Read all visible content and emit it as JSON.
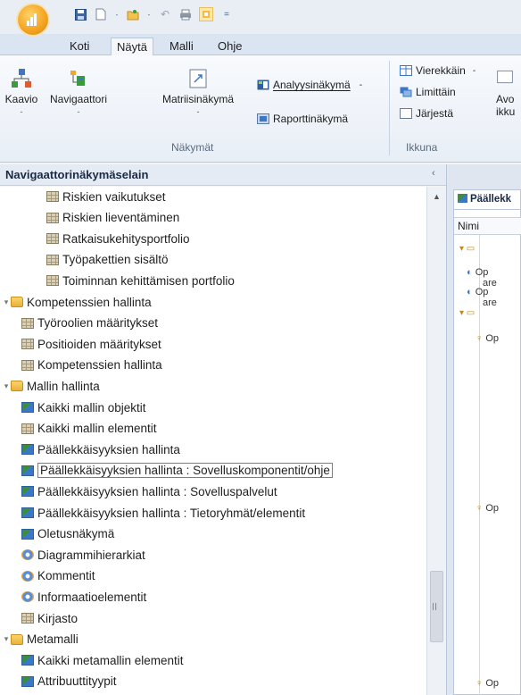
{
  "tabs": [
    "Koti",
    "Näytä",
    "Malli",
    "Ohje"
  ],
  "active_tab": "Näytä",
  "ribbon": {
    "large_buttons": [
      {
        "label": "Kaavio",
        "dropdown": "-"
      },
      {
        "label": "Navigaattori",
        "dropdown": "-"
      },
      {
        "label": "Matriisinäkymä",
        "dropdown": "-"
      }
    ],
    "view_buttons": [
      {
        "label": "Analyysinäkymä",
        "dropdown": "-"
      },
      {
        "label": "Raporttinäkymä"
      }
    ],
    "group_nakymat": "Näkymät",
    "window_buttons": [
      {
        "label": "Vierekkäin",
        "dropdown": "-"
      },
      {
        "label": "Limittäin"
      },
      {
        "label": "Järjestä"
      }
    ],
    "window_partial": {
      "line1": "Avo",
      "line2": "ikku"
    },
    "group_ikkuna": "Ikkuna"
  },
  "navigator": {
    "title": "Navigaattorinäkymäselain",
    "collapse_glyph": "‹",
    "items": [
      {
        "label": "Riskien vaikutukset",
        "level": 2,
        "icon": "grid"
      },
      {
        "label": "Riskien lieventäminen",
        "level": 2,
        "icon": "grid"
      },
      {
        "label": "Ratkaisukehitysportfolio",
        "level": 2,
        "icon": "grid"
      },
      {
        "label": "Työpakettien sisältö",
        "level": 2,
        "icon": "grid"
      },
      {
        "label": "Toiminnan kehittämisen portfolio",
        "level": 2,
        "icon": "grid"
      },
      {
        "label": "Kompetenssien hallinta",
        "level": 0,
        "icon": "folder"
      },
      {
        "label": "Työroolien määritykset",
        "level": 1,
        "icon": "grid"
      },
      {
        "label": "Positioiden määritykset",
        "level": 1,
        "icon": "grid"
      },
      {
        "label": "Kompetenssien hallinta",
        "level": 1,
        "icon": "grid"
      },
      {
        "label": "Mallin hallinta",
        "level": 0,
        "icon": "folder"
      },
      {
        "label": "Kaikki mallin objektit",
        "level": 1,
        "icon": "view"
      },
      {
        "label": "Kaikki mallin elementit",
        "level": 1,
        "icon": "grid"
      },
      {
        "label": "Päällekkäisyyksien hallinta",
        "level": 1,
        "icon": "view"
      },
      {
        "label": "Päällekkäisyyksien hallinta : Sovelluskomponentit/ohje",
        "level": 1,
        "icon": "view",
        "selected": true
      },
      {
        "label": "Päällekkäisyyksien hallinta : Sovelluspalvelut",
        "level": 1,
        "icon": "view"
      },
      {
        "label": "Päällekkäisyyksien hallinta : Tietoryhmät/elementit",
        "level": 1,
        "icon": "view"
      },
      {
        "label": "Oletusnäkymä",
        "level": 1,
        "icon": "view"
      },
      {
        "label": "Diagrammihierarkiat",
        "level": 1,
        "icon": "gear"
      },
      {
        "label": "Kommentit",
        "level": 1,
        "icon": "gear"
      },
      {
        "label": "Informaatioelementit",
        "level": 1,
        "icon": "gear"
      },
      {
        "label": "Kirjasto",
        "level": 1,
        "icon": "grid"
      },
      {
        "label": "Metamalli",
        "level": 0,
        "icon": "folder"
      },
      {
        "label": "Kaikki metamallin elementit",
        "level": 1,
        "icon": "view"
      },
      {
        "label": "Attribuuttityypit",
        "level": 1,
        "icon": "view"
      }
    ]
  },
  "document": {
    "tab_label": "Päällekk",
    "column_header": "Nimi",
    "rows": [
      "Op",
      "are",
      "Op",
      "are",
      "Op",
      "Op",
      "Op"
    ]
  },
  "colors": {
    "accent": "#f5a623",
    "ribbon_bg": "#f8fafd",
    "tab_strip": "#dbe4f1"
  }
}
